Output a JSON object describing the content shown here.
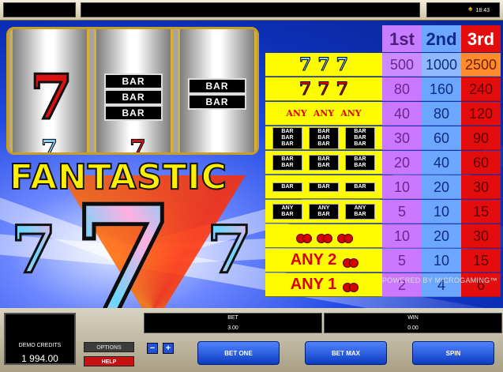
{
  "top_bar": {
    "clock": "18:43",
    "clock_icon": "lamp-icon"
  },
  "game": {
    "reels": {
      "reel1": {
        "main": "7"
      },
      "reel2": {
        "row1": "BAR",
        "row2": "BAR",
        "row3": "BAR"
      },
      "reel3": {
        "row1": "BAR",
        "row2": "BAR"
      },
      "top_labels": [
        "BAR",
        "BAR",
        "BAR"
      ]
    },
    "title": "FANTASTIC",
    "center_symbol": "7",
    "powered_by": "POWERED BY MICROGAMING™"
  },
  "paytable": {
    "headers": [
      "1st",
      "2nd",
      "3rd"
    ],
    "rows": [
      {
        "symbols": "seven-blue",
        "values": [
          "500",
          "1000",
          "2500"
        ]
      },
      {
        "symbols": "seven-red",
        "values": [
          "80",
          "160",
          "240"
        ]
      },
      {
        "symbols": "any-seven",
        "values": [
          "40",
          "80",
          "120"
        ]
      },
      {
        "symbols": "triple-bar",
        "values": [
          "30",
          "60",
          "90"
        ]
      },
      {
        "symbols": "double-bar",
        "values": [
          "20",
          "40",
          "60"
        ]
      },
      {
        "symbols": "single-bar",
        "values": [
          "10",
          "20",
          "30"
        ]
      },
      {
        "symbols": "any-bar",
        "values": [
          "5",
          "10",
          "15"
        ]
      },
      {
        "symbols": "cherry-3",
        "values": [
          "10",
          "20",
          "30"
        ]
      },
      {
        "symbols": "any-2-cherry",
        "label": "ANY 2",
        "values": [
          "5",
          "10",
          "15"
        ]
      },
      {
        "symbols": "any-1-cherry",
        "label": "ANY 1",
        "values": [
          "2",
          "4",
          "6"
        ]
      }
    ],
    "sym_text": {
      "bar": "BAR",
      "any": "ANY"
    }
  },
  "console": {
    "credits_label": "DEMO CREDITS",
    "credits_value": "1 994.00",
    "bet_label": "BET",
    "bet_value": "3.00",
    "win_label": "WIN",
    "win_value": "0.00",
    "options_label": "OPTIONS",
    "help_label": "HELP",
    "minus": "−",
    "plus": "+",
    "bet_one": "BET ONE",
    "bet_max": "BET MAX",
    "spin": "SPIN"
  }
}
